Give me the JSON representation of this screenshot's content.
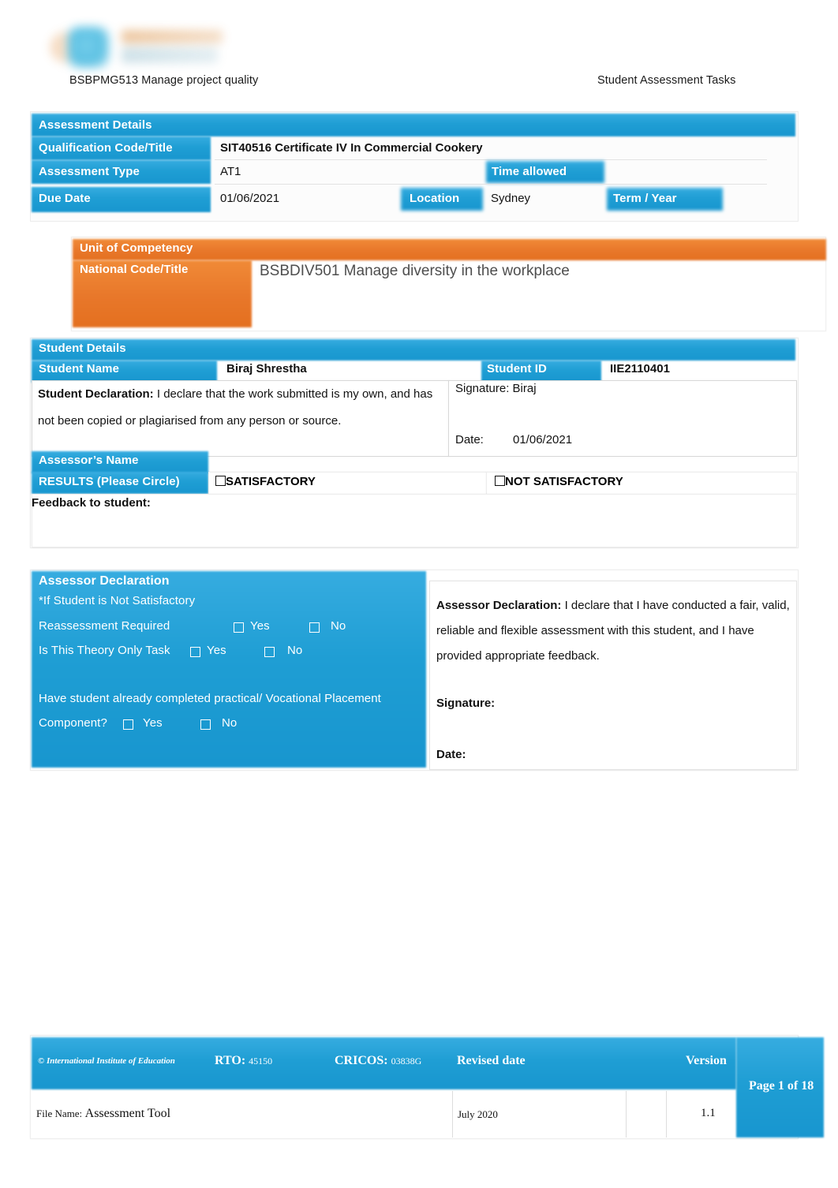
{
  "header": {
    "logo_alt": "International Institute of Education logo",
    "left_text": "BSBPMG513 Manage project quality",
    "right_text": "Student Assessment Tasks"
  },
  "assessment_details": {
    "section_title": "Assessment Details",
    "qualification_label": "Qualification Code/Title",
    "qualification_value": "SIT40516 Certificate IV In Commercial Cookery",
    "type_label": "Assessment Type",
    "type_value": "AT1",
    "time_allowed_label": "Time allowed",
    "time_allowed_value": "",
    "due_date_label": "Due Date",
    "due_date_value": "01/06/2021",
    "location_label": "Location",
    "location_value": "Sydney",
    "term_year_label": "Term / Year",
    "term_year_value": ""
  },
  "unit_of_competency": {
    "title_line1": "Unit of Competency",
    "title_line2": "National Code/Title",
    "value": "BSBDIV501 Manage diversity in the workplace"
  },
  "student_details": {
    "section_title": "Student Details",
    "name_label": "Student Name",
    "name_value": "Biraj Shrestha",
    "id_label": "Student ID",
    "id_value": "IIE2110401",
    "declaration_label": "Student Declaration:",
    "declaration_line1": "I declare that the work submitted is my own,",
    "declaration_line2": "and has not been copied or plagiarised from any person or source.",
    "signature_label": "Signature: Biraj",
    "date_label": "Date:",
    "date_value": "01/06/2021"
  },
  "results": {
    "assessor_name_label": "Assessor’s Name",
    "assessor_name_value": "",
    "results_label": "RESULTS (Please Circle)",
    "satisfactory_label": "SATISFACTORY",
    "not_satisfactory_label": "NOT SATISFACTORY",
    "feedback_label": "Feedback to student:",
    "feedback_value": ""
  },
  "assessor_declaration": {
    "section_title": "Assessor Declaration",
    "note": "*If Student is Not Satisfactory",
    "reassessment_label": "Reassessment Required",
    "reassessment_yes": "Yes",
    "reassessment_no": "No",
    "theory_only_label": "Is This Theory Only Task",
    "theory_only_yes": "Yes",
    "theory_only_no": "No",
    "placement_line1": "Have student already completed practical/ Vocational Placement",
    "placement_line2": "Component?",
    "placement_yes": "Yes",
    "placement_no": "No",
    "declaration_label": "Assessor Declaration:",
    "declaration_line1": "I declare that I have conducted a fair,",
    "declaration_line2": "valid, reliable and flexible assessment with this student, and I",
    "declaration_line3": "have provided appropriate feedback.",
    "signature_label": "Signature:",
    "date_label": "Date:"
  },
  "footer": {
    "copyright": "© International Institute of Education",
    "rto_label": "RTO:",
    "rto_value": "45150",
    "cricos_label": "CRICOS:",
    "cricos_value": "03838G",
    "revised_date_label": "Revised date",
    "version_label": "Version",
    "page_label": "Page 1 of 18",
    "file_name_label": "File Name:",
    "file_name_value": "Assessment Tool",
    "revised_date_value": "July 2020",
    "version_value": "1.1"
  },
  "colors": {
    "brand_blue": "#1f9ed4",
    "brand_blue_light": "#36ace0",
    "brand_orange": "#e8772a",
    "text_dark": "#121212",
    "panel_bg": "#fcfcfc"
  }
}
